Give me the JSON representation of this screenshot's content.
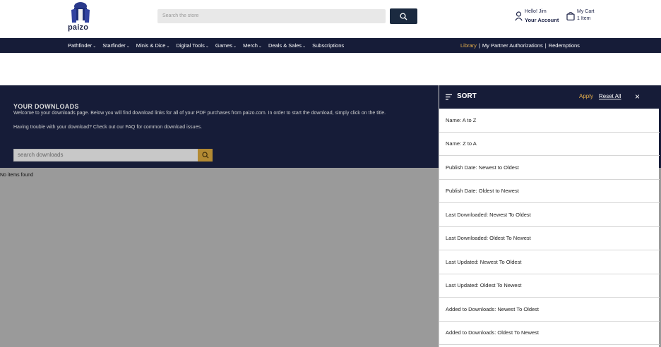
{
  "header": {
    "logo_text": "paizo",
    "search_placeholder": "Search the store",
    "hello_text": "Hello! Jim",
    "account_label": "Your Account",
    "cart_label": "My Cart",
    "cart_items": "1 Item"
  },
  "nav": {
    "items": [
      {
        "label": "Pathfinder"
      },
      {
        "label": "Starfinder"
      },
      {
        "label": "Minis & Dice"
      },
      {
        "label": "Digital Tools"
      },
      {
        "label": "Games"
      },
      {
        "label": "Merch"
      },
      {
        "label": "Deals & Sales"
      },
      {
        "label": "Subscriptions"
      }
    ],
    "right_links": [
      {
        "label": "Library"
      },
      {
        "label": "My Partner Authorizations"
      },
      {
        "label": "Redemptions"
      }
    ],
    "separator": "|",
    "chevron": "⌄"
  },
  "downloads": {
    "title": "YOUR DOWNLOADS",
    "welcome": "Welcome to your downloads page. Below you will find download links for all of your PDF purchases from paizo.com. In order to start the download, simply click on the title.",
    "trouble": "Having trouble with your download? Check out our FAQ for common download issues.",
    "search_placeholder": "search downloads",
    "empty_text": "No items found"
  },
  "sort_panel": {
    "title": "SORT",
    "apply_label": "Apply",
    "reset_label": "Reset All",
    "close_glyph": "×",
    "options": [
      {
        "label": "Name: A to Z"
      },
      {
        "label": "Name: Z to A"
      },
      {
        "label": "Publish Date: Newest to Oldest"
      },
      {
        "label": "Publish Date: Oldest to Newest"
      },
      {
        "label": "Last Downloaded: Newest To Oldest"
      },
      {
        "label": "Last Downloaded: Oldest To Newest"
      },
      {
        "label": "Last Updated: Newest To Oldest"
      },
      {
        "label": "Last Updated: Oldest To Newest"
      },
      {
        "label": "Added to Downloads: Newest To Oldest"
      },
      {
        "label": "Added to Downloads: Oldest To Newest"
      }
    ]
  },
  "colors": {
    "navy": "#161c38",
    "gold": "#e7b04c",
    "search_button": "#1b2a40",
    "download_search_button": "#b38a33"
  },
  "icons": {
    "logo": "paizo-goblin-logo",
    "search": "search-icon",
    "account": "user-icon",
    "cart": "bag-icon",
    "sort_menu": "sort-lines-icon",
    "close": "close-icon"
  }
}
